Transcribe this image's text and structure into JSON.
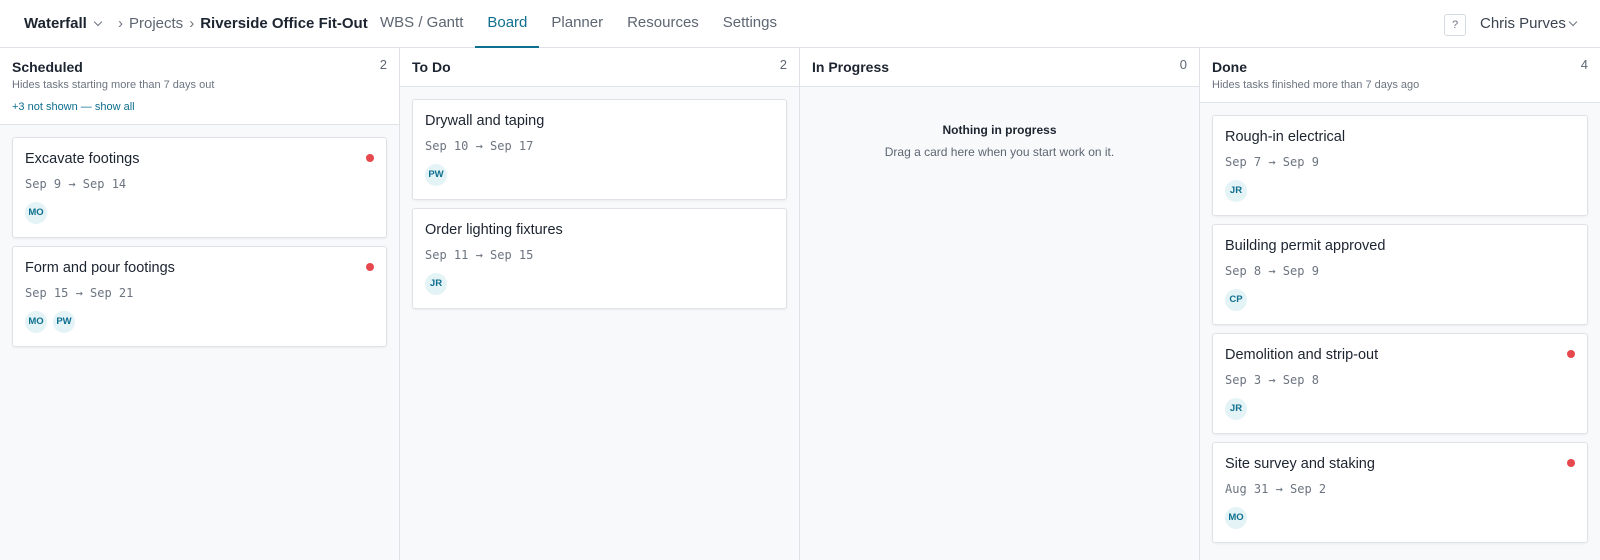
{
  "header": {
    "app_name": "Waterfall",
    "breadcrumb_sep": "›",
    "breadcrumb_projects": "Projects",
    "project_name": "Riverside Office Fit-Out",
    "tabs": [
      {
        "label": "WBS / Gantt",
        "active": false
      },
      {
        "label": "Board",
        "active": true
      },
      {
        "label": "Planner",
        "active": false
      },
      {
        "label": "Resources",
        "active": false
      },
      {
        "label": "Settings",
        "active": false
      }
    ],
    "help_label": "?",
    "user_name": "Chris Purves"
  },
  "colors": {
    "accent": "#0f6f8f",
    "flag": "#e5484d",
    "avatar_bg": "#e3f3f6"
  },
  "columns": [
    {
      "title": "Scheduled",
      "count": "2",
      "subtitle": "Hides tasks starting more than 7 days out",
      "link": "+3 not shown — show all",
      "cards": [
        {
          "title": "Excavate footings",
          "dates": "Sep 9 → Sep 14",
          "avatars": [
            "MO"
          ],
          "flagged": true
        },
        {
          "title": "Form and pour footings",
          "dates": "Sep 15 → Sep 21",
          "avatars": [
            "MO",
            "PW"
          ],
          "flagged": true
        }
      ]
    },
    {
      "title": "To Do",
      "count": "2",
      "cards": [
        {
          "title": "Drywall and taping",
          "dates": "Sep 10 → Sep 17",
          "avatars": [
            "PW"
          ],
          "flagged": false
        },
        {
          "title": "Order lighting fixtures",
          "dates": "Sep 11 → Sep 15",
          "avatars": [
            "JR"
          ],
          "flagged": false
        }
      ]
    },
    {
      "title": "In Progress",
      "count": "0",
      "empty_title": "Nothing in progress",
      "empty_text": "Drag a card here when you start work on it.",
      "cards": []
    },
    {
      "title": "Done",
      "count": "4",
      "subtitle": "Hides tasks finished more than 7 days ago",
      "cards": [
        {
          "title": "Rough-in electrical",
          "dates": "Sep 7 → Sep 9",
          "avatars": [
            "JR"
          ],
          "flagged": false
        },
        {
          "title": "Building permit approved",
          "dates": "Sep 8 → Sep 9",
          "avatars": [
            "CP"
          ],
          "flagged": false
        },
        {
          "title": "Demolition and strip-out",
          "dates": "Sep 3 → Sep 8",
          "avatars": [
            "JR"
          ],
          "flagged": true
        },
        {
          "title": "Site survey and staking",
          "dates": "Aug 31 → Sep 2",
          "avatars": [
            "MO"
          ],
          "flagged": true
        }
      ]
    }
  ]
}
